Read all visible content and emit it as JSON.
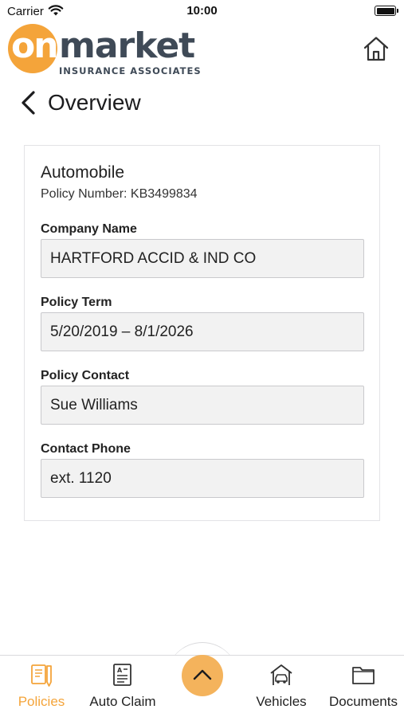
{
  "status_bar": {
    "carrier": "Carrier",
    "time": "10:00"
  },
  "brand": {
    "logo_prefix": "on",
    "logo_main": "market",
    "logo_sub": "INSURANCE ASSOCIATES",
    "accent_color": "#f4a43a",
    "dark_color": "#3f4a57"
  },
  "header": {
    "home_icon": "home-icon"
  },
  "nav": {
    "back_icon": "chevron-left-icon",
    "title": "Overview"
  },
  "policy": {
    "type": "Automobile",
    "number_line": "Policy Number: KB3499834",
    "fields": [
      {
        "label": "Company Name",
        "value": "HARTFORD ACCID & IND CO"
      },
      {
        "label": "Policy Term",
        "value": "5/20/2019 – 8/1/2026"
      },
      {
        "label": "Policy Contact",
        "value": "Sue Williams"
      },
      {
        "label": "Contact Phone",
        "value": "ext. 1120"
      }
    ]
  },
  "tab_bar": {
    "tabs": [
      {
        "label": "Policies",
        "icon": "policy-document-icon",
        "active": true
      },
      {
        "label": "Auto Claim",
        "icon": "claim-form-icon",
        "active": false
      },
      {
        "label": "Vehicles",
        "icon": "car-garage-icon",
        "active": false
      },
      {
        "label": "Documents",
        "icon": "folder-icon",
        "active": false
      }
    ],
    "fab_icon": "chevron-up-icon"
  }
}
